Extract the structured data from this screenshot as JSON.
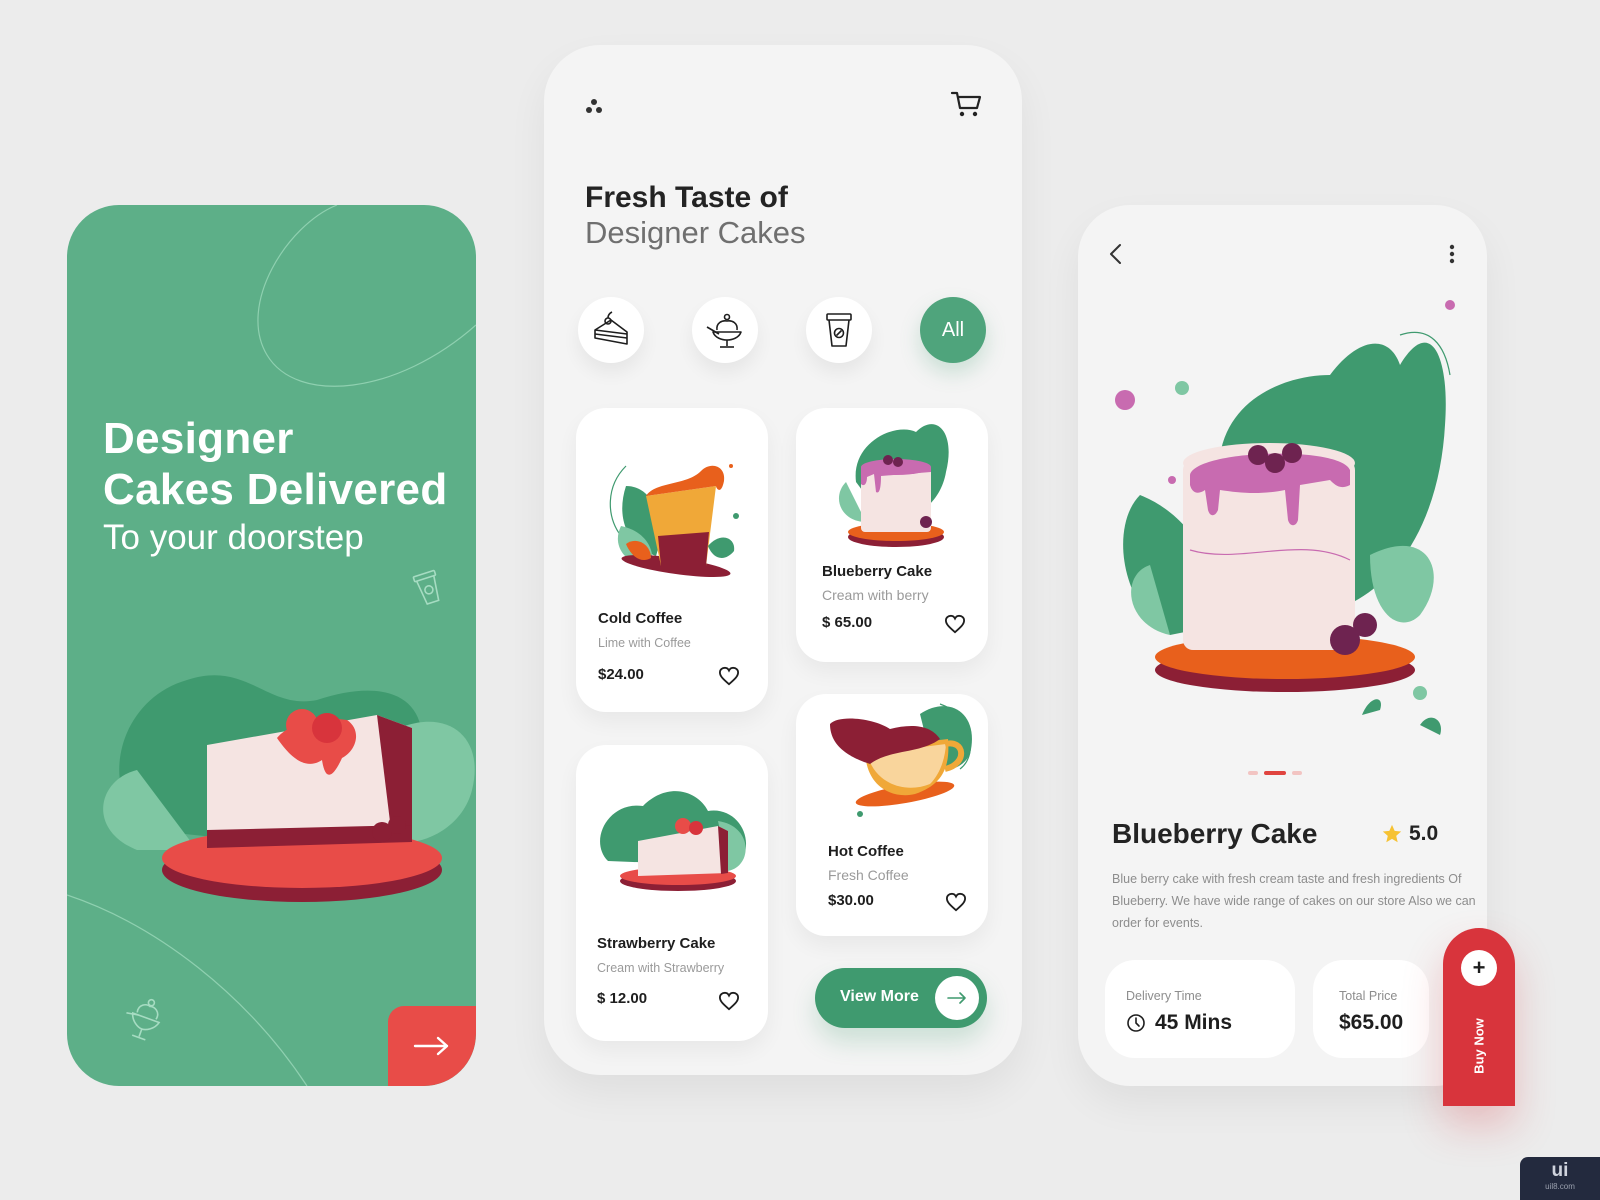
{
  "colors": {
    "splash_green": "#5daf88",
    "accent_green": "#4fa47c",
    "accent_red": "#e84c48",
    "buy_red": "#d8343c",
    "star_yellow": "#f6c233"
  },
  "splash": {
    "title_line1": "Designer",
    "title_line2": "Cakes Delivered",
    "subtitle": "To your doorstep",
    "next_icon": "arrow-right-icon",
    "decorative_icons": [
      "coffee-cup-icon",
      "sundae-icon"
    ],
    "illustration": "strawberry-cake-slice"
  },
  "menu": {
    "logo_icon": "dots-logo-icon",
    "cart_icon": "cart-icon",
    "title": "Fresh Taste of",
    "subtitle": "Designer Cakes",
    "categories": [
      {
        "icon": "cake-slice-icon",
        "label": ""
      },
      {
        "icon": "sundae-icon",
        "label": ""
      },
      {
        "icon": "coffee-cup-icon",
        "label": ""
      },
      {
        "icon": "",
        "label": "All",
        "active": true
      }
    ],
    "products": [
      {
        "name": "Cold Coffee",
        "desc": "Lime with Coffee",
        "price": "$24.00"
      },
      {
        "name": "Blueberry Cake",
        "desc": "Cream with berry",
        "price": "$ 65.00"
      },
      {
        "name": "Strawberry Cake",
        "desc": "Cream with Strawberry",
        "price": "$ 12.00"
      },
      {
        "name": "Hot Coffee",
        "desc": "Fresh Coffee",
        "price": "$30.00"
      }
    ],
    "view_more_label": "View More"
  },
  "detail": {
    "back_icon": "chevron-left-icon",
    "more_icon": "more-vertical-icon",
    "carousel": {
      "total": 3,
      "active": 2
    },
    "title": "Blueberry Cake",
    "rating": "5.0",
    "description": "Blue berry cake with fresh cream taste and  fresh ingredients Of Blueberry. We have wide range of cakes on our store Also we can order for events.",
    "delivery_label": "Delivery Time",
    "delivery_value": "45 Mins",
    "total_label": "Total Price",
    "total_value": "$65.00",
    "buy_label": "Buy Now",
    "buy_plus": "+"
  },
  "watermark": {
    "main": "ui",
    "sub": "uil8.com"
  }
}
